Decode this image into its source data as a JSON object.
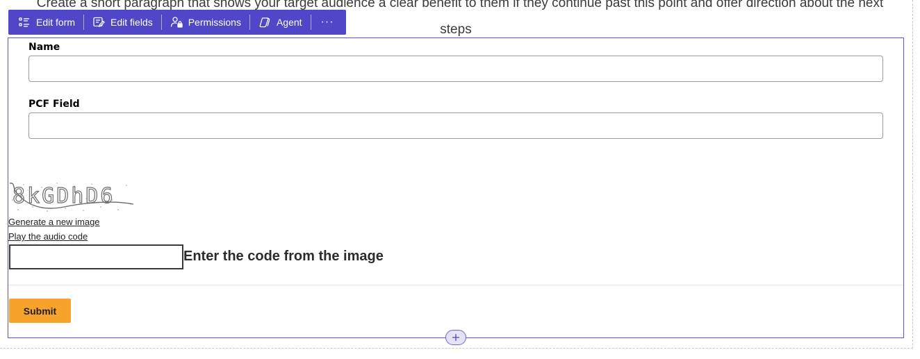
{
  "background_text": {
    "line1": "Create a short paragraph that shows your target audience a clear benefit to them if they continue past this point and offer direction about the next",
    "line2": "steps"
  },
  "toolbar": {
    "edit_form": {
      "label": "Edit form",
      "icon": "list-icon"
    },
    "edit_fields": {
      "label": "Edit fields",
      "icon": "edit-grid-icon"
    },
    "permissions": {
      "label": "Permissions",
      "icon": "person-lock-icon"
    },
    "agent": {
      "label": "Agent",
      "icon": "copilot-icon"
    },
    "more": {
      "label": "···",
      "icon": "more-horizontal-icon"
    }
  },
  "form": {
    "fields": [
      {
        "label": "Name",
        "value": "",
        "placeholder": ""
      },
      {
        "label": "PCF Field",
        "value": "",
        "placeholder": ""
      }
    ],
    "captcha": {
      "code_text": "8kGDhD6",
      "generate_link": "Generate a new image",
      "audio_link": "Play the audio code",
      "code_input_value": "",
      "code_label": "Enter the code from the image"
    },
    "submit_label": "Submit"
  },
  "colors": {
    "toolbar_bg": "#4f46c8",
    "frame_border": "#5b57c7",
    "submit_bg": "#f7a22b"
  }
}
